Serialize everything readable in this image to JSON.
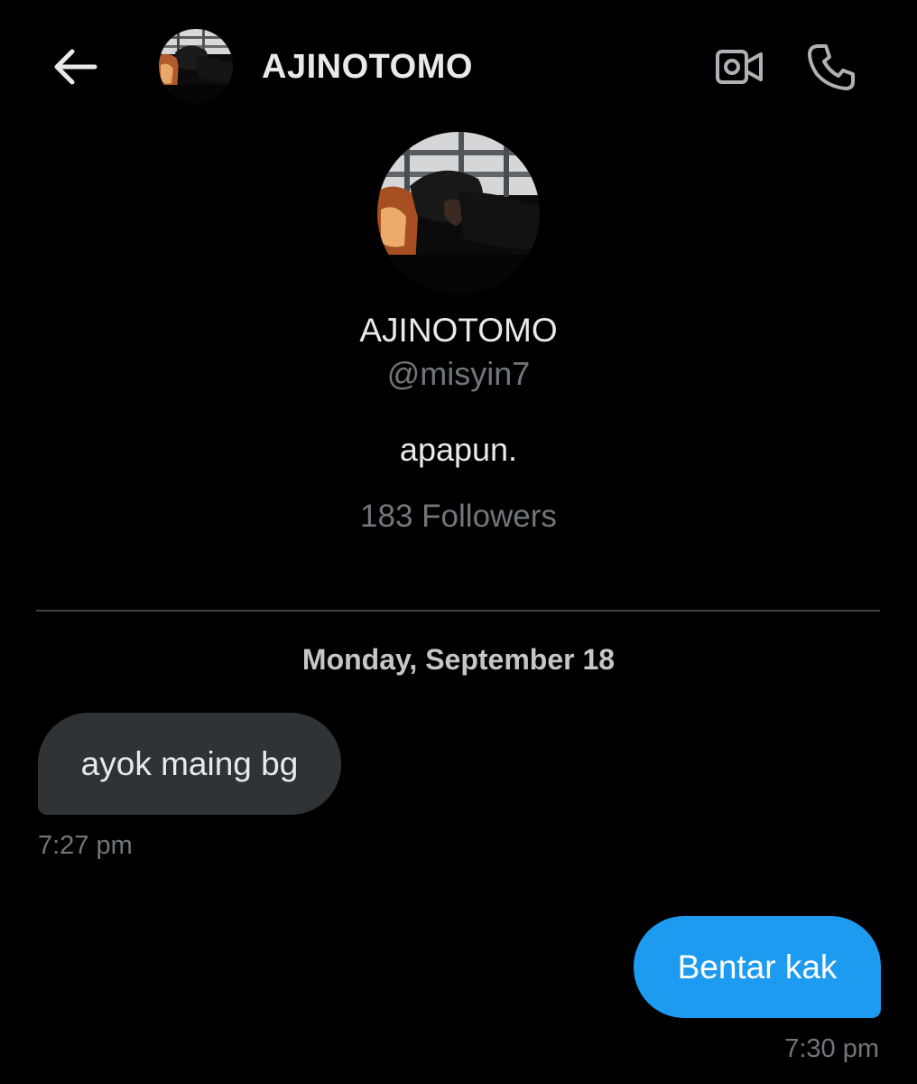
{
  "header": {
    "title": "AJINOTOMO",
    "back_icon": "arrow-left-icon",
    "video_icon": "video-camera-icon",
    "call_icon": "phone-icon"
  },
  "profile": {
    "name": "AJINOTOMO",
    "handle": "@misyin7",
    "bio": "apapun.",
    "followers": "183 Followers"
  },
  "conversation": {
    "date_separator": "Monday, September 18",
    "messages": [
      {
        "direction": "received",
        "text": "ayok maing bg",
        "time": "7:27 pm"
      },
      {
        "direction": "sent",
        "text": "Bentar kak",
        "time": "7:30 pm"
      }
    ]
  },
  "colors": {
    "background": "#000000",
    "received_bubble": "#2f3336",
    "sent_bubble": "#1d9bf0",
    "secondary_text": "#71767b"
  }
}
